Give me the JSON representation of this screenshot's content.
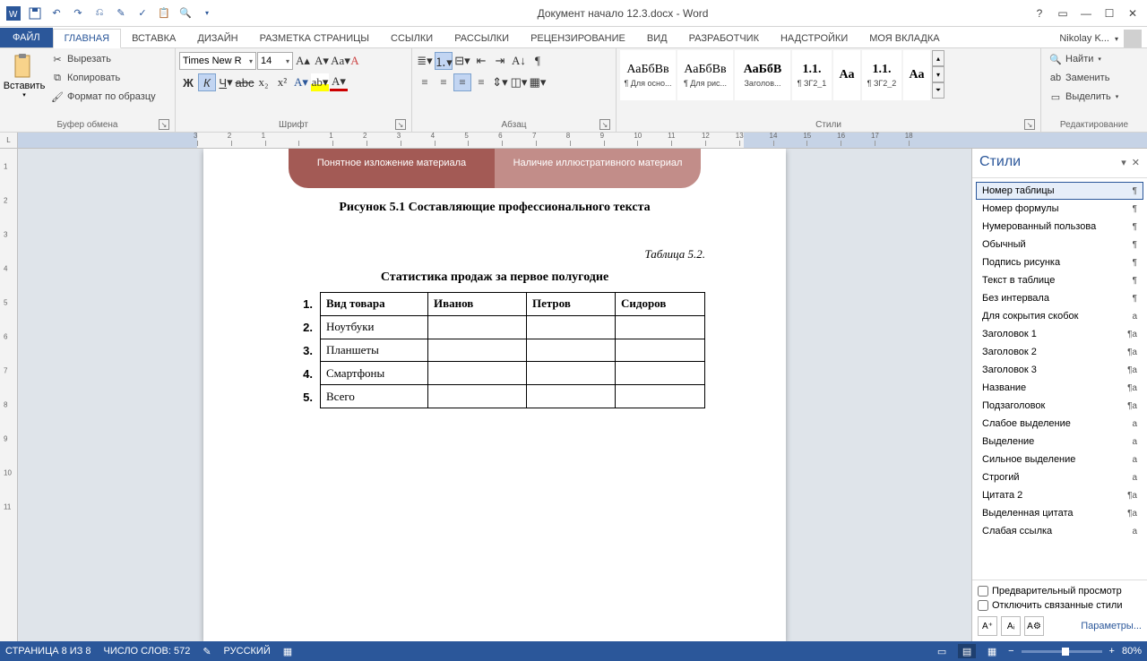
{
  "title": "Документ начало 12.3.docx - Word",
  "user": "Nikolay K...",
  "tabs": {
    "file": "ФАЙЛ",
    "items": [
      "ГЛАВНАЯ",
      "ВСТАВКА",
      "ДИЗАЙН",
      "РАЗМЕТКА СТРАНИЦЫ",
      "ССЫЛКИ",
      "РАССЫЛКИ",
      "РЕЦЕНЗИРОВАНИЕ",
      "ВИД",
      "РАЗРАБОТЧИК",
      "НАДСТРОЙКИ",
      "МОЯ ВКЛАДКА"
    ],
    "active": 0
  },
  "ribbon": {
    "clipboard": {
      "paste": "Вставить",
      "cut": "Вырезать",
      "copy": "Копировать",
      "format": "Формат по образцу",
      "label": "Буфер обмена"
    },
    "font": {
      "name": "Times New R",
      "size": "14",
      "label": "Шрифт"
    },
    "para": {
      "label": "Абзац"
    },
    "styles": {
      "label": "Стили",
      "items": [
        {
          "preview": "АаБбВв",
          "name": "¶ Для осно..."
        },
        {
          "preview": "АаБбВв",
          "name": "¶ Для рис..."
        },
        {
          "preview": "АаБбВ",
          "name": "Заголов..."
        },
        {
          "preview": "1.1.",
          "name": "¶ ЗГ2_1"
        },
        {
          "preview": "Аа",
          "name": ""
        },
        {
          "preview": "1.1.",
          "name": "¶ ЗГ2_2"
        },
        {
          "preview": "Аа",
          "name": ""
        }
      ]
    },
    "editing": {
      "find": "Найти",
      "replace": "Заменить",
      "select": "Выделить",
      "label": "Редактирование"
    }
  },
  "doc": {
    "sa_left": "Понятное изложение материала",
    "sa_right": "Наличие иллюстративного материал",
    "caption": "Рисунок 5.1 Составляющие профессионального текста",
    "table_num": "Таблица 5.2.",
    "table_title": "Статистика продаж за первое полугодие",
    "list": [
      "1.",
      "2.",
      "3.",
      "4.",
      "5."
    ],
    "headers": [
      "Вид товара",
      "Иванов",
      "Петров",
      "Сидоров"
    ],
    "rows": [
      "Ноутбуки",
      "Планшеты",
      "Смартфоны",
      "Всего"
    ]
  },
  "styles_pane": {
    "title": "Стили",
    "items": [
      {
        "name": "Номер таблицы",
        "mark": "¶",
        "sel": true
      },
      {
        "name": "Номер формулы",
        "mark": "¶"
      },
      {
        "name": "Нумерованный пользова",
        "mark": "¶"
      },
      {
        "name": "Обычный",
        "mark": "¶"
      },
      {
        "name": "Подпись рисунка",
        "mark": "¶"
      },
      {
        "name": "Текст в таблице",
        "mark": "¶"
      },
      {
        "name": "Без интервала",
        "mark": "¶"
      },
      {
        "name": "Для сокрытия скобок",
        "mark": "a"
      },
      {
        "name": "Заголовок 1",
        "mark": "¶a"
      },
      {
        "name": "Заголовок 2",
        "mark": "¶a"
      },
      {
        "name": "Заголовок 3",
        "mark": "¶a"
      },
      {
        "name": "Название",
        "mark": "¶a"
      },
      {
        "name": "Подзаголовок",
        "mark": "¶a"
      },
      {
        "name": "Слабое выделение",
        "mark": "a"
      },
      {
        "name": "Выделение",
        "mark": "a"
      },
      {
        "name": "Сильное выделение",
        "mark": "a"
      },
      {
        "name": "Строгий",
        "mark": "a"
      },
      {
        "name": "Цитата 2",
        "mark": "¶a"
      },
      {
        "name": "Выделенная цитата",
        "mark": "¶a"
      },
      {
        "name": "Слабая ссылка",
        "mark": "a"
      }
    ],
    "preview_chk": "Предварительный просмотр",
    "linked_chk": "Отключить связанные стили",
    "params": "Параметры..."
  },
  "status": {
    "page": "СТРАНИЦА 8 ИЗ 8",
    "words": "ЧИСЛО СЛОВ: 572",
    "lang": "РУССКИЙ",
    "zoom": "80%"
  }
}
